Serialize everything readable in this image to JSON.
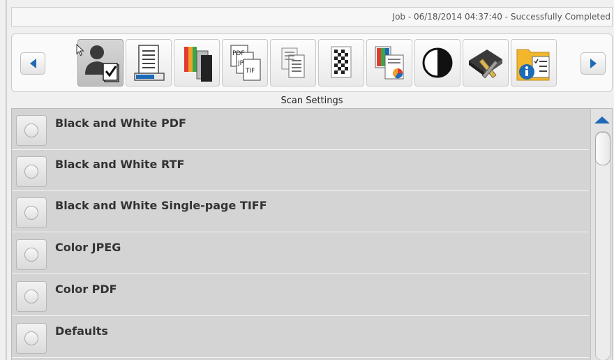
{
  "status": {
    "message": "Job - 06/18/2014 04:37:40 - Successfully Completed"
  },
  "toolbar": {
    "icons": [
      "user-profile-icon",
      "scanner-document-icon",
      "color-documents-icon",
      "file-formats-icon",
      "multi-page-icon",
      "pixel-grid-icon",
      "color-chart-icon",
      "contrast-icon",
      "scanner-tools-icon",
      "folder-info-icon"
    ],
    "format_labels": {
      "pdf": "PDF",
      "jpg": "JP",
      "tif": "TIF"
    },
    "selected_index": 0
  },
  "section": {
    "title": "Scan Settings"
  },
  "settings": {
    "items": [
      {
        "label": "Black and White PDF"
      },
      {
        "label": "Black and White RTF"
      },
      {
        "label": "Black and White Single-page TIFF"
      },
      {
        "label": "Color JPEG"
      },
      {
        "label": "Color PDF"
      },
      {
        "label": "Defaults"
      }
    ]
  },
  "colors": {
    "accent": "#1d6ab6",
    "list_background": "#d4d4d4",
    "selected_button": "#c4c4c4"
  }
}
